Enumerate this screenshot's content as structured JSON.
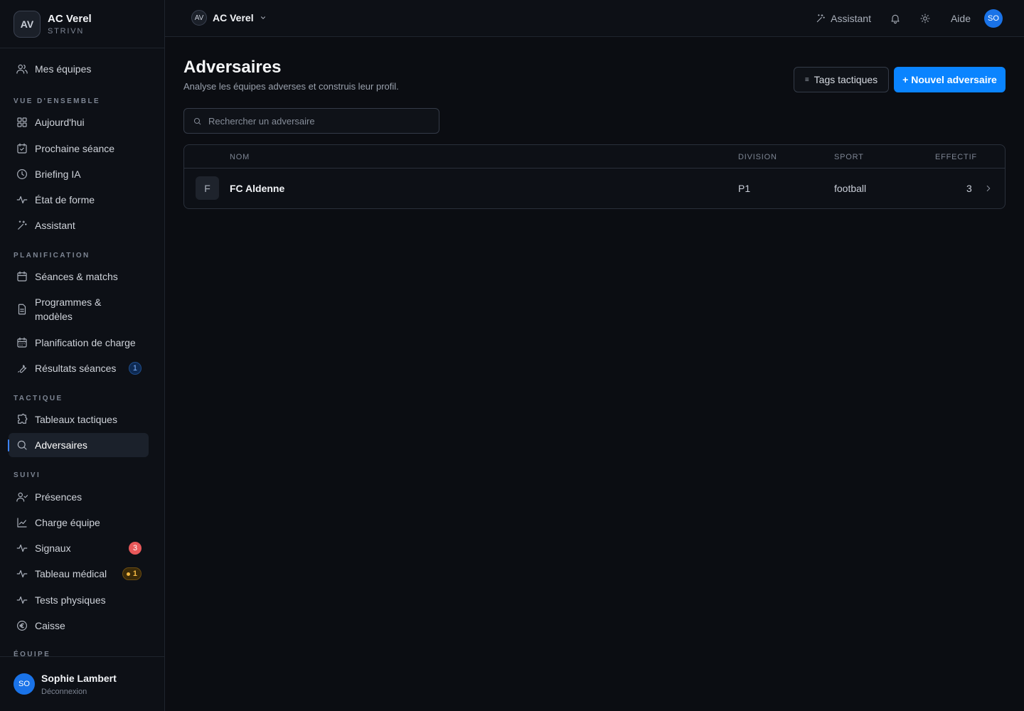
{
  "brand": {
    "initials": "AV",
    "title": "AC Verel",
    "subtitle": "STRIVN"
  },
  "sidebar": {
    "top_item": {
      "label": "Mes équipes",
      "icon": "users-icon"
    },
    "sections": [
      {
        "label": "VUE D'ENSEMBLE"
      },
      {
        "label": "PLANIFICATION"
      },
      {
        "label": "TACTIQUE"
      },
      {
        "label": "SUIVI"
      },
      {
        "label": "ÉQUIPE"
      }
    ],
    "items": [
      {
        "label": "Aujourd'hui",
        "icon": "grid-icon"
      },
      {
        "label": "Prochaine séance",
        "icon": "calendar-check-icon"
      },
      {
        "label": "Briefing IA",
        "icon": "clock-icon"
      },
      {
        "label": "État de forme",
        "icon": "pulse-icon"
      },
      {
        "label": "Assistant",
        "icon": "sparkle-wand-icon"
      },
      {
        "label": "Séances & matchs",
        "icon": "calendar-icon"
      },
      {
        "label": "Programmes & modèles",
        "icon": "document-icon"
      },
      {
        "label": "Planification de charge",
        "icon": "calendar-grid-icon"
      },
      {
        "label": "Résultats séances",
        "icon": "wrench-icon",
        "badge": "1"
      },
      {
        "label": "Tableaux tactiques",
        "icon": "puzzle-icon"
      },
      {
        "label": "Adversaires",
        "icon": "search-icon",
        "active": true
      },
      {
        "label": "Présences",
        "icon": "user-check-icon"
      },
      {
        "label": "Charge équipe",
        "icon": "line-chart-icon"
      },
      {
        "label": "Signaux",
        "icon": "pulse-icon",
        "badge": "3"
      },
      {
        "label": "Tableau médical",
        "icon": "pulse-icon",
        "badge": "1"
      },
      {
        "label": "Tests physiques",
        "icon": "pulse-icon"
      },
      {
        "label": "Caisse",
        "icon": "euro-icon"
      }
    ]
  },
  "user": {
    "initials": "SO",
    "name": "Sophie Lambert",
    "logout": "Déconnexion"
  },
  "topbar": {
    "org_initials": "AV",
    "org_name": "AC Verel",
    "assistant_label": "Assistant",
    "help_label": "Aide",
    "avatar_initials": "SO"
  },
  "page": {
    "title": "Adversaires",
    "subtitle": "Analyse les équipes adverses et construis leur profil.",
    "tags_button": "Tags tactiques",
    "new_button": "+ Nouvel adversaire",
    "search_placeholder": "Rechercher un adversaire"
  },
  "table": {
    "columns": {
      "name": "NOM",
      "division": "DIVISION",
      "sport": "SPORT",
      "effectif": "EFFECTIF"
    },
    "rows": [
      {
        "initial": "F",
        "name": "FC Aldenne",
        "division": "P1",
        "sport": "football",
        "effectif": "3"
      }
    ]
  },
  "colors": {
    "accent": "#0a84ff",
    "badge_red": "#e8585a",
    "badge_amber": "#f5b942",
    "badge_blue": "#7fb2ff"
  }
}
